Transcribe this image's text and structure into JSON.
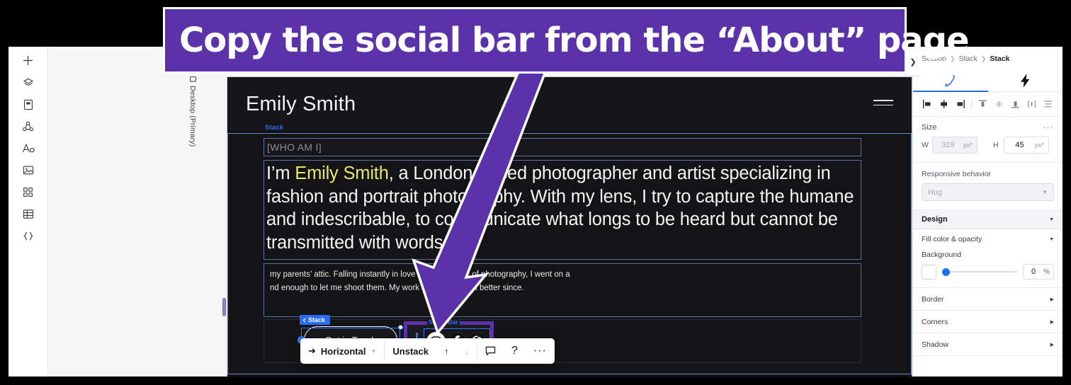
{
  "callout": {
    "text": "Copy the social bar from the “About” page",
    "bg": "#5c32ab",
    "fg": "#ffffff"
  },
  "left_rail": {
    "items": [
      {
        "name": "add-icon",
        "label": "Add"
      },
      {
        "name": "layers-icon",
        "label": "Layers"
      },
      {
        "name": "pages-icon",
        "label": "Pages"
      },
      {
        "name": "cms-icon",
        "label": "CMS"
      },
      {
        "name": "text-icon",
        "label": "Text"
      },
      {
        "name": "media-icon",
        "label": "Media"
      },
      {
        "name": "apps-icon",
        "label": "Apps"
      },
      {
        "name": "table-icon",
        "label": "Table"
      },
      {
        "name": "code-icon",
        "label": "Code"
      }
    ]
  },
  "canvas": {
    "breakpoint_label": "Desktop (Primary)",
    "site": {
      "logo": "Emily Smith",
      "eyebrow": "[WHO AM I]",
      "paragraph_plain": "I’m Emily Smith, a London-based photographer and artist specializing in fashion and portrait photography. With my lens, I try to capture the humane and indescribable, to communicate what longs to be heard but cannot be transmitted with words.",
      "paragraph_prefix": "I’m ",
      "paragraph_highlight": "Emily Smith",
      "paragraph_rest": ", a London-based photographer and artist specializing in fashion and portrait photography. With my lens, I try to capture the humane and indescribable, to communicate what longs to be heard but cannot be transmitted with words.",
      "body_line1": "my parents’ attic. Falling instantly in love with the magic of photography, I went on a",
      "body_line2": "nd enough to let me shoot them. My work has gotten a lot better since.",
      "cta_label": "Get in Touch"
    },
    "labels": {
      "stack_top": "Stack",
      "stack_button": "Stack",
      "social_bar": "Social Bar"
    },
    "social_icons": [
      {
        "name": "instagram-icon",
        "label": "Instagram"
      },
      {
        "name": "facebook-icon",
        "label": "Facebook"
      },
      {
        "name": "pinterest-icon",
        "label": "Pinterest"
      }
    ]
  },
  "context_toolbar": {
    "direction_label": "Horizontal",
    "unstack_label": "Unstack",
    "move_up_label": "↑",
    "move_down_label": "↓",
    "comment_label": "Comment",
    "help_label": "?",
    "more_label": "···"
  },
  "inspector": {
    "breadcrumb": [
      "Section",
      "Stack",
      "Stack"
    ],
    "tabs": [
      {
        "name": "tab-design",
        "icon": "brush-icon",
        "active": true
      },
      {
        "name": "tab-interactions",
        "icon": "lightning-icon",
        "active": false
      }
    ],
    "align_buttons": [
      "align-left-icon",
      "align-center-horizontal-icon",
      "align-right-icon",
      "align-top-icon",
      "align-middle-icon",
      "align-bottom-icon",
      "distribute-horizontal-icon",
      "distribute-vertical-icon"
    ],
    "size": {
      "title": "Size",
      "more": "···",
      "w_label": "W",
      "w_value": "319",
      "w_unit": "px*",
      "h_label": "H",
      "h_value": "45",
      "h_unit": "px*"
    },
    "responsive": {
      "label": "Responsive behavior",
      "value": "Hug"
    },
    "design": {
      "title": "Design"
    },
    "fill": {
      "title": "Fill color & opacity",
      "background_label": "Background",
      "opacity_value": "0",
      "opacity_unit": "%",
      "swatch_color": "#ffffff",
      "slider_accent": "#1a73e8"
    },
    "accordions": [
      "Border",
      "Corners",
      "Shadow"
    ],
    "collapse_chevron": "❯"
  }
}
